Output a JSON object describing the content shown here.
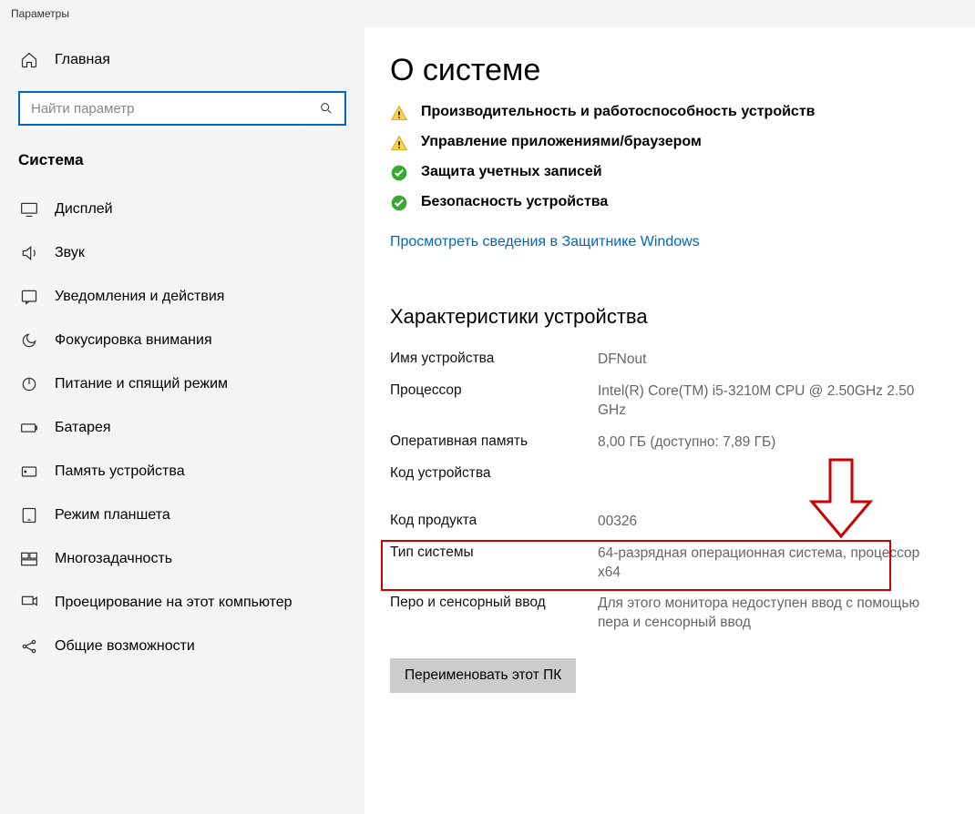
{
  "window_title": "Параметры",
  "sidebar": {
    "home": "Главная",
    "search_placeholder": "Найти параметр",
    "section": "Система",
    "items": [
      {
        "label": "Дисплей"
      },
      {
        "label": "Звук"
      },
      {
        "label": "Уведомления и действия"
      },
      {
        "label": "Фокусировка внимания"
      },
      {
        "label": "Питание и спящий режим"
      },
      {
        "label": "Батарея"
      },
      {
        "label": "Память устройства"
      },
      {
        "label": "Режим планшета"
      },
      {
        "label": "Многозадачность"
      },
      {
        "label": "Проецирование на этот компьютер"
      },
      {
        "label": "Общие возможности"
      }
    ]
  },
  "main": {
    "title": "О системе",
    "status": [
      {
        "label": "Производительность и работоспособность устройств",
        "state": "warn"
      },
      {
        "label": "Управление приложениями/браузером",
        "state": "warn"
      },
      {
        "label": "Защита учетных записей",
        "state": "ok"
      },
      {
        "label": "Безопасность устройства",
        "state": "ok"
      }
    ],
    "defender_link": "Просмотреть сведения в Защитнике Windows",
    "specs_heading": "Характеристики устройства",
    "specs": {
      "device_name_label": "Имя устройства",
      "device_name": "DFNout",
      "cpu_label": "Процессор",
      "cpu": "Intel(R) Core(TM) i5-3210M CPU @ 2.50GHz   2.50 GHz",
      "ram_label": "Оперативная память",
      "ram": "8,00 ГБ (доступно: 7,89 ГБ)",
      "device_id_label": "Код устройства",
      "device_id": "",
      "product_id_label": "Код продукта",
      "product_id": "00326",
      "system_type_label": "Тип системы",
      "system_type": "64-разрядная операционная система, процессор x64",
      "pen_touch_label": "Перо и сенсорный ввод",
      "pen_touch": "Для этого монитора недоступен ввод с помощью пера и сенсорный ввод"
    },
    "rename_button": "Переименовать этот ПК"
  }
}
